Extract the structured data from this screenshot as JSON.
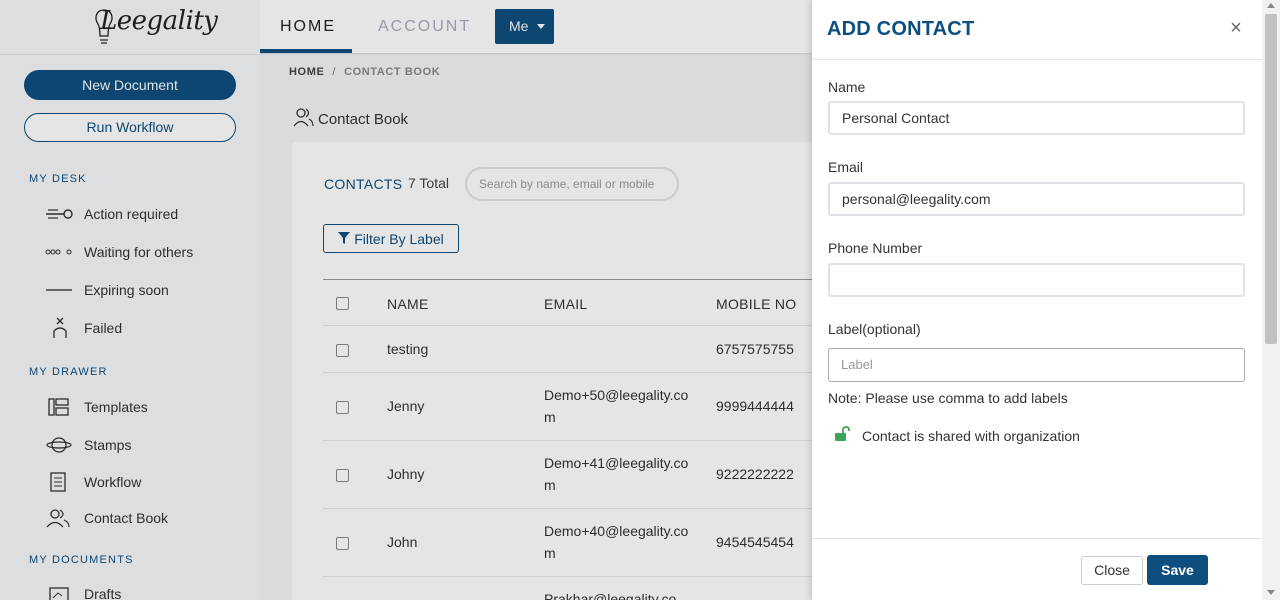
{
  "app": {
    "logo_text": "Leegality"
  },
  "sidebar": {
    "new_document": "New Document",
    "run_workflow": "Run Workflow",
    "sections": {
      "my_desk": "MY DESK",
      "my_drawer": "MY DRAWER",
      "my_documents": "MY DOCUMENTS"
    },
    "desk_items": [
      {
        "label": "Action required",
        "icon": "action-required-icon"
      },
      {
        "label": "Waiting for others",
        "icon": "waiting-dots-icon"
      },
      {
        "label": "Expiring soon",
        "icon": "expiring-icon"
      },
      {
        "label": "Failed",
        "icon": "failed-icon"
      }
    ],
    "drawer_items": [
      {
        "label": "Templates",
        "icon": "templates-icon"
      },
      {
        "label": "Stamps",
        "icon": "stamps-icon"
      },
      {
        "label": "Workflow",
        "icon": "workflow-icon"
      },
      {
        "label": "Contact Book",
        "icon": "contact-book-icon"
      }
    ],
    "document_items": [
      {
        "label": "Drafts",
        "icon": "drafts-icon"
      }
    ]
  },
  "header": {
    "tabs": [
      {
        "label": "HOME"
      },
      {
        "label": "ACCOUNT"
      }
    ],
    "me_button": "Me"
  },
  "breadcrumb": {
    "home": "HOME",
    "separator": "/",
    "current": "CONTACT BOOK"
  },
  "page": {
    "title": "Contact Book"
  },
  "contacts": {
    "label": "CONTACTS",
    "total": "7 Total",
    "search_placeholder": "Search by name, email or mobile",
    "filter_label": "Filter By Label",
    "columns": [
      "NAME",
      "EMAIL",
      "MOBILE NO"
    ],
    "rows": [
      {
        "name": "testing",
        "email_line1": "",
        "email_line2": "",
        "mobile": "6757575755"
      },
      {
        "name": "Jenny",
        "email_line1": "Demo+50@leegality.co",
        "email_line2": "m",
        "mobile": "9999444444"
      },
      {
        "name": "Johny",
        "email_line1": "Demo+41@leegality.co",
        "email_line2": "m",
        "mobile": "9222222222"
      },
      {
        "name": "John",
        "email_line1": "Demo+40@leegality.co",
        "email_line2": "m",
        "mobile": "9454545454"
      },
      {
        "name": "",
        "email_line1": "Prakhar@leegality.co",
        "email_line2": "",
        "mobile": ""
      }
    ]
  },
  "drawer": {
    "title": "ADD CONTACT",
    "close_x": "×",
    "fields": {
      "name": {
        "label": "Name",
        "value": "Personal Contact"
      },
      "email": {
        "label": "Email",
        "value": "personal@leegality.com"
      },
      "phone": {
        "label": "Phone Number",
        "value": ""
      },
      "label": {
        "label": "Label(optional)",
        "placeholder": "Label"
      }
    },
    "note": "Note: Please use comma to add labels",
    "shared_text": "Contact is shared with organization",
    "close_button": "Close",
    "save_button": "Save"
  },
  "colors": {
    "brand": "#0e4e7e",
    "unlock_green": "#3aa655"
  }
}
